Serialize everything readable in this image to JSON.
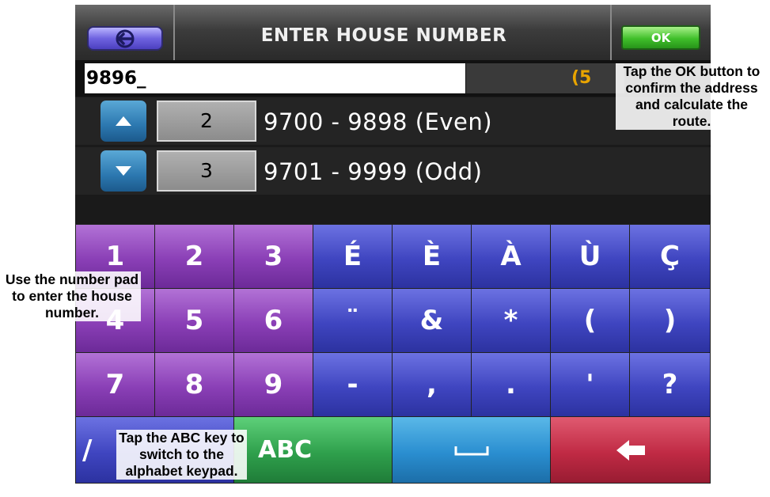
{
  "header": {
    "title": "ENTER HOUSE NUMBER",
    "ok_label": "OK"
  },
  "input": {
    "value": "9896_",
    "badge": "(5"
  },
  "ranges": [
    {
      "count": "2",
      "text": "9700 - 9898 (Even)"
    },
    {
      "count": "3",
      "text": "9701 - 9999 (Odd)"
    }
  ],
  "keys": {
    "row1": [
      "1",
      "2",
      "3",
      "É",
      "È",
      "À",
      "Ù",
      "Ç"
    ],
    "row2": [
      "4",
      "5",
      "6",
      "¨",
      "&",
      "*",
      "(",
      ")"
    ],
    "row3": [
      "7",
      "8",
      "9",
      "-",
      ",",
      ".",
      "'",
      "?"
    ],
    "slash": "/",
    "abc": "ABC"
  },
  "callouts": {
    "ok": "Tap the OK button to confirm the address and calculate the route.",
    "number_pad": "Use the number pad to enter the house number.",
    "abc": "Tap the ABC key to switch to the alphabet keypad."
  },
  "icons": {
    "back": "back-arrow-icon",
    "up": "triangle-up-icon",
    "down": "triangle-down-icon",
    "space": "space-bar-icon",
    "backspace": "backspace-arrow-icon"
  },
  "colors": {
    "number_keys": "#8a3fb6",
    "symbol_keys": "#3f45c0",
    "abc_key": "#2fa04c",
    "space_key": "#2a8ed0",
    "backspace_key": "#c02a44",
    "ok_button": "#3fbf2a"
  }
}
